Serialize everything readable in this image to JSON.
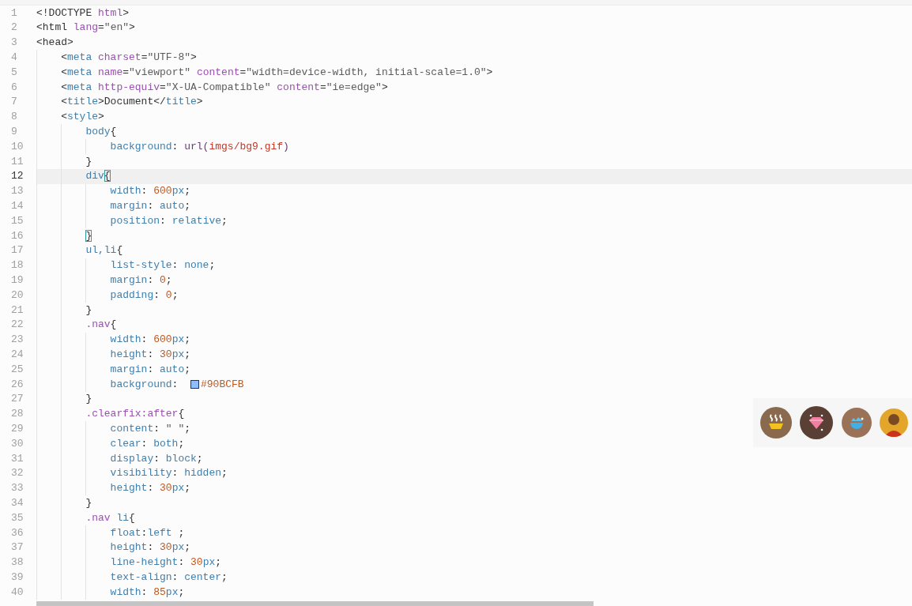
{
  "editor": {
    "lines": [
      {
        "number": "1",
        "current": false,
        "tokens": [
          {
            "text": "<!DOCTYPE ",
            "kind": "plain"
          },
          {
            "text": "html",
            "kind": "keyword"
          },
          {
            "text": ">",
            "kind": "plain"
          }
        ]
      },
      {
        "number": "2",
        "current": false,
        "tokens": [
          {
            "text": "<html ",
            "kind": "plain"
          },
          {
            "text": "lang",
            "kind": "keyword"
          },
          {
            "text": "=",
            "kind": "plain"
          },
          {
            "text": "\"en\"",
            "kind": "string"
          },
          {
            "text": ">",
            "kind": "plain"
          }
        ]
      },
      {
        "number": "3",
        "current": false,
        "tokens": [
          {
            "text": "<head>",
            "kind": "plain"
          }
        ],
        "children": [
          {
            "number": "4",
            "current": false,
            "tokens": [
              {
                "text": "<",
                "kind": "plain"
              },
              {
                "text": "meta ",
                "kind": "name"
              },
              {
                "text": "charset",
                "kind": "keyword"
              },
              {
                "text": "=",
                "kind": "plain"
              },
              {
                "text": "\"UTF-8\"",
                "kind": "string"
              },
              {
                "text": ">",
                "kind": "plain"
              }
            ]
          },
          {
            "number": "5",
            "current": false,
            "tokens": [
              {
                "text": "<",
                "kind": "plain"
              },
              {
                "text": "meta ",
                "kind": "name"
              },
              {
                "text": "name",
                "kind": "keyword"
              },
              {
                "text": "=",
                "kind": "plain"
              },
              {
                "text": "\"viewport\" ",
                "kind": "string"
              },
              {
                "text": "content",
                "kind": "keyword"
              },
              {
                "text": "=",
                "kind": "plain"
              },
              {
                "text": "\"width=device-width, initial-scale=1.0\"",
                "kind": "string"
              },
              {
                "text": ">",
                "kind": "plain"
              }
            ]
          },
          {
            "number": "6",
            "current": false,
            "tokens": [
              {
                "text": "<",
                "kind": "plain"
              },
              {
                "text": "meta ",
                "kind": "name"
              },
              {
                "text": "http-equiv",
                "kind": "keyword"
              },
              {
                "text": "=",
                "kind": "plain"
              },
              {
                "text": "\"X-UA-Compatible\" ",
                "kind": "string"
              },
              {
                "text": "content",
                "kind": "keyword"
              },
              {
                "text": "=",
                "kind": "plain"
              },
              {
                "text": "\"ie=edge\"",
                "kind": "string"
              },
              {
                "text": ">",
                "kind": "plain"
              }
            ]
          },
          {
            "number": "7",
            "current": false,
            "tokens": [
              {
                "text": "<",
                "kind": "plain"
              },
              {
                "text": "title",
                "kind": "name"
              },
              {
                "text": ">Document</",
                "kind": "plain"
              },
              {
                "text": "title",
                "kind": "name"
              },
              {
                "text": ">",
                "kind": "plain"
              }
            ]
          },
          {
            "number": "8",
            "current": false,
            "tokens": [
              {
                "text": "<",
                "kind": "plain"
              },
              {
                "text": "style",
                "kind": "name"
              },
              {
                "text": ">",
                "kind": "plain"
              }
            ],
            "children": [
              {
                "number": "9",
                "current": false,
                "tokens": [
                  {
                    "text": "body",
                    "kind": "name"
                  },
                  {
                    "text": "{",
                    "kind": "plain"
                  }
                ],
                "children": [
                  {
                    "number": "10",
                    "current": false,
                    "tokens": [
                      {
                        "text": "background",
                        "kind": "name"
                      },
                      {
                        "text": ": ",
                        "kind": "plain"
                      },
                      {
                        "text": "url(",
                        "kind": "func"
                      },
                      {
                        "text": "imgs/bg9.gif",
                        "kind": "link"
                      },
                      {
                        "text": ")",
                        "kind": "func"
                      }
                    ]
                  }
                ]
              },
              {
                "number": "11",
                "current": false,
                "tokens": [
                  {
                    "text": "}",
                    "kind": "plain"
                  }
                ]
              },
              {
                "number": "12",
                "current": true,
                "tokens": [
                  {
                    "text": "div",
                    "kind": "name"
                  },
                  {
                    "text": "{",
                    "kind": "bracket"
                  }
                ],
                "children": [
                  {
                    "number": "13",
                    "current": false,
                    "tokens": [
                      {
                        "text": "width",
                        "kind": "name"
                      },
                      {
                        "text": ": ",
                        "kind": "plain"
                      },
                      {
                        "text": "600",
                        "kind": "number"
                      },
                      {
                        "text": "px",
                        "kind": "name"
                      },
                      {
                        "text": ";",
                        "kind": "plain"
                      }
                    ]
                  },
                  {
                    "number": "14",
                    "current": false,
                    "tokens": [
                      {
                        "text": "margin",
                        "kind": "name"
                      },
                      {
                        "text": ": ",
                        "kind": "plain"
                      },
                      {
                        "text": "auto",
                        "kind": "name"
                      },
                      {
                        "text": ";",
                        "kind": "plain"
                      }
                    ]
                  },
                  {
                    "number": "15",
                    "current": false,
                    "tokens": [
                      {
                        "text": "position",
                        "kind": "name"
                      },
                      {
                        "text": ": ",
                        "kind": "plain"
                      },
                      {
                        "text": "relative",
                        "kind": "name"
                      },
                      {
                        "text": ";",
                        "kind": "plain"
                      }
                    ]
                  }
                ]
              },
              {
                "number": "16",
                "current": false,
                "tokens": [
                  {
                    "text": "}",
                    "kind": "bracket"
                  }
                ]
              },
              {
                "number": "17",
                "current": false,
                "tokens": [
                  {
                    "text": "ul,li",
                    "kind": "name"
                  },
                  {
                    "text": "{",
                    "kind": "plain"
                  }
                ],
                "children": [
                  {
                    "number": "18",
                    "current": false,
                    "tokens": [
                      {
                        "text": "list-style",
                        "kind": "name"
                      },
                      {
                        "text": ": ",
                        "kind": "plain"
                      },
                      {
                        "text": "none",
                        "kind": "name"
                      },
                      {
                        "text": ";",
                        "kind": "plain"
                      }
                    ]
                  },
                  {
                    "number": "19",
                    "current": false,
                    "tokens": [
                      {
                        "text": "margin",
                        "kind": "name"
                      },
                      {
                        "text": ": ",
                        "kind": "plain"
                      },
                      {
                        "text": "0",
                        "kind": "number"
                      },
                      {
                        "text": ";",
                        "kind": "plain"
                      }
                    ]
                  },
                  {
                    "number": "20",
                    "current": false,
                    "tokens": [
                      {
                        "text": "padding",
                        "kind": "name"
                      },
                      {
                        "text": ": ",
                        "kind": "plain"
                      },
                      {
                        "text": "0",
                        "kind": "number"
                      },
                      {
                        "text": ";",
                        "kind": "plain"
                      }
                    ]
                  }
                ]
              },
              {
                "number": "21",
                "current": false,
                "tokens": [
                  {
                    "text": "}",
                    "kind": "plain"
                  }
                ]
              },
              {
                "number": "22",
                "current": false,
                "tokens": [
                  {
                    "text": ".nav",
                    "kind": "keyword"
                  },
                  {
                    "text": "{",
                    "kind": "plain"
                  }
                ],
                "children": [
                  {
                    "number": "23",
                    "current": false,
                    "tokens": [
                      {
                        "text": "width",
                        "kind": "name"
                      },
                      {
                        "text": ": ",
                        "kind": "plain"
                      },
                      {
                        "text": "600",
                        "kind": "number"
                      },
                      {
                        "text": "px",
                        "kind": "name"
                      },
                      {
                        "text": ";",
                        "kind": "plain"
                      }
                    ]
                  },
                  {
                    "number": "24",
                    "current": false,
                    "tokens": [
                      {
                        "text": "height",
                        "kind": "name"
                      },
                      {
                        "text": ": ",
                        "kind": "plain"
                      },
                      {
                        "text": "30",
                        "kind": "number"
                      },
                      {
                        "text": "px",
                        "kind": "name"
                      },
                      {
                        "text": ";",
                        "kind": "plain"
                      }
                    ]
                  },
                  {
                    "number": "25",
                    "current": false,
                    "tokens": [
                      {
                        "text": "margin",
                        "kind": "name"
                      },
                      {
                        "text": ": ",
                        "kind": "plain"
                      },
                      {
                        "text": "auto",
                        "kind": "name"
                      },
                      {
                        "text": ";",
                        "kind": "plain"
                      }
                    ]
                  },
                  {
                    "number": "26",
                    "current": false,
                    "tokens": [
                      {
                        "text": "background",
                        "kind": "name"
                      },
                      {
                        "text": ":  ",
                        "kind": "plain"
                      },
                      {
                        "text": "#90BCFB",
                        "kind": "hex",
                        "color": "#90bcfb"
                      }
                    ]
                  }
                ]
              },
              {
                "number": "27",
                "current": false,
                "tokens": [
                  {
                    "text": "}",
                    "kind": "plain"
                  }
                ]
              },
              {
                "number": "28",
                "current": false,
                "tokens": [
                  {
                    "text": ".clearfix:after",
                    "kind": "keyword"
                  },
                  {
                    "text": "{",
                    "kind": "plain"
                  }
                ],
                "children": [
                  {
                    "number": "29",
                    "current": false,
                    "tokens": [
                      {
                        "text": "content",
                        "kind": "name"
                      },
                      {
                        "text": ": ",
                        "kind": "plain"
                      },
                      {
                        "text": "\" \"",
                        "kind": "string"
                      },
                      {
                        "text": ";",
                        "kind": "plain"
                      }
                    ]
                  },
                  {
                    "number": "30",
                    "current": false,
                    "tokens": [
                      {
                        "text": "clear",
                        "kind": "name"
                      },
                      {
                        "text": ": ",
                        "kind": "plain"
                      },
                      {
                        "text": "both",
                        "kind": "name"
                      },
                      {
                        "text": ";",
                        "kind": "plain"
                      }
                    ]
                  },
                  {
                    "number": "31",
                    "current": false,
                    "tokens": [
                      {
                        "text": "display",
                        "kind": "name"
                      },
                      {
                        "text": ": ",
                        "kind": "plain"
                      },
                      {
                        "text": "block",
                        "kind": "name"
                      },
                      {
                        "text": ";",
                        "kind": "plain"
                      }
                    ]
                  },
                  {
                    "number": "32",
                    "current": false,
                    "tokens": [
                      {
                        "text": "visibility",
                        "kind": "name"
                      },
                      {
                        "text": ": ",
                        "kind": "plain"
                      },
                      {
                        "text": "hidden",
                        "kind": "name"
                      },
                      {
                        "text": ";",
                        "kind": "plain"
                      }
                    ]
                  },
                  {
                    "number": "33",
                    "current": false,
                    "tokens": [
                      {
                        "text": "height",
                        "kind": "name"
                      },
                      {
                        "text": ": ",
                        "kind": "plain"
                      },
                      {
                        "text": "30",
                        "kind": "number"
                      },
                      {
                        "text": "px",
                        "kind": "name"
                      },
                      {
                        "text": ";",
                        "kind": "plain"
                      }
                    ]
                  }
                ]
              },
              {
                "number": "34",
                "current": false,
                "tokens": [
                  {
                    "text": "}",
                    "kind": "plain"
                  }
                ]
              },
              {
                "number": "35",
                "current": false,
                "tokens": [
                  {
                    "text": ".nav",
                    "kind": "keyword"
                  },
                  {
                    "text": " li",
                    "kind": "name"
                  },
                  {
                    "text": "{",
                    "kind": "plain"
                  }
                ],
                "children": [
                  {
                    "number": "36",
                    "current": false,
                    "tokens": [
                      {
                        "text": "float",
                        "kind": "name"
                      },
                      {
                        "text": ":",
                        "kind": "plain"
                      },
                      {
                        "text": "left",
                        "kind": "name"
                      },
                      {
                        "text": " ;",
                        "kind": "plain"
                      }
                    ]
                  },
                  {
                    "number": "37",
                    "current": false,
                    "tokens": [
                      {
                        "text": "height",
                        "kind": "name"
                      },
                      {
                        "text": ": ",
                        "kind": "plain"
                      },
                      {
                        "text": "30",
                        "kind": "number"
                      },
                      {
                        "text": "px",
                        "kind": "name"
                      },
                      {
                        "text": ";",
                        "kind": "plain"
                      }
                    ]
                  },
                  {
                    "number": "38",
                    "current": false,
                    "tokens": [
                      {
                        "text": "line-height",
                        "kind": "name"
                      },
                      {
                        "text": ": ",
                        "kind": "plain"
                      },
                      {
                        "text": "30",
                        "kind": "number"
                      },
                      {
                        "text": "px",
                        "kind": "name"
                      },
                      {
                        "text": ";",
                        "kind": "plain"
                      }
                    ]
                  },
                  {
                    "number": "39",
                    "current": false,
                    "tokens": [
                      {
                        "text": "text-align",
                        "kind": "name"
                      },
                      {
                        "text": ": ",
                        "kind": "plain"
                      },
                      {
                        "text": "center",
                        "kind": "name"
                      },
                      {
                        "text": ";",
                        "kind": "plain"
                      }
                    ]
                  },
                  {
                    "number": "40",
                    "current": false,
                    "tokens": [
                      {
                        "text": "width",
                        "kind": "name"
                      },
                      {
                        "text": ": ",
                        "kind": "plain"
                      },
                      {
                        "text": "85",
                        "kind": "number"
                      },
                      {
                        "text": "px",
                        "kind": "name"
                      },
                      {
                        "text": ";",
                        "kind": "plain"
                      }
                    ]
                  }
                ]
              }
            ]
          }
        ]
      }
    ]
  },
  "floating_buttons": [
    {
      "kind": "bowl"
    },
    {
      "kind": "gem"
    },
    {
      "kind": "egg"
    },
    {
      "kind": "avatar"
    }
  ]
}
